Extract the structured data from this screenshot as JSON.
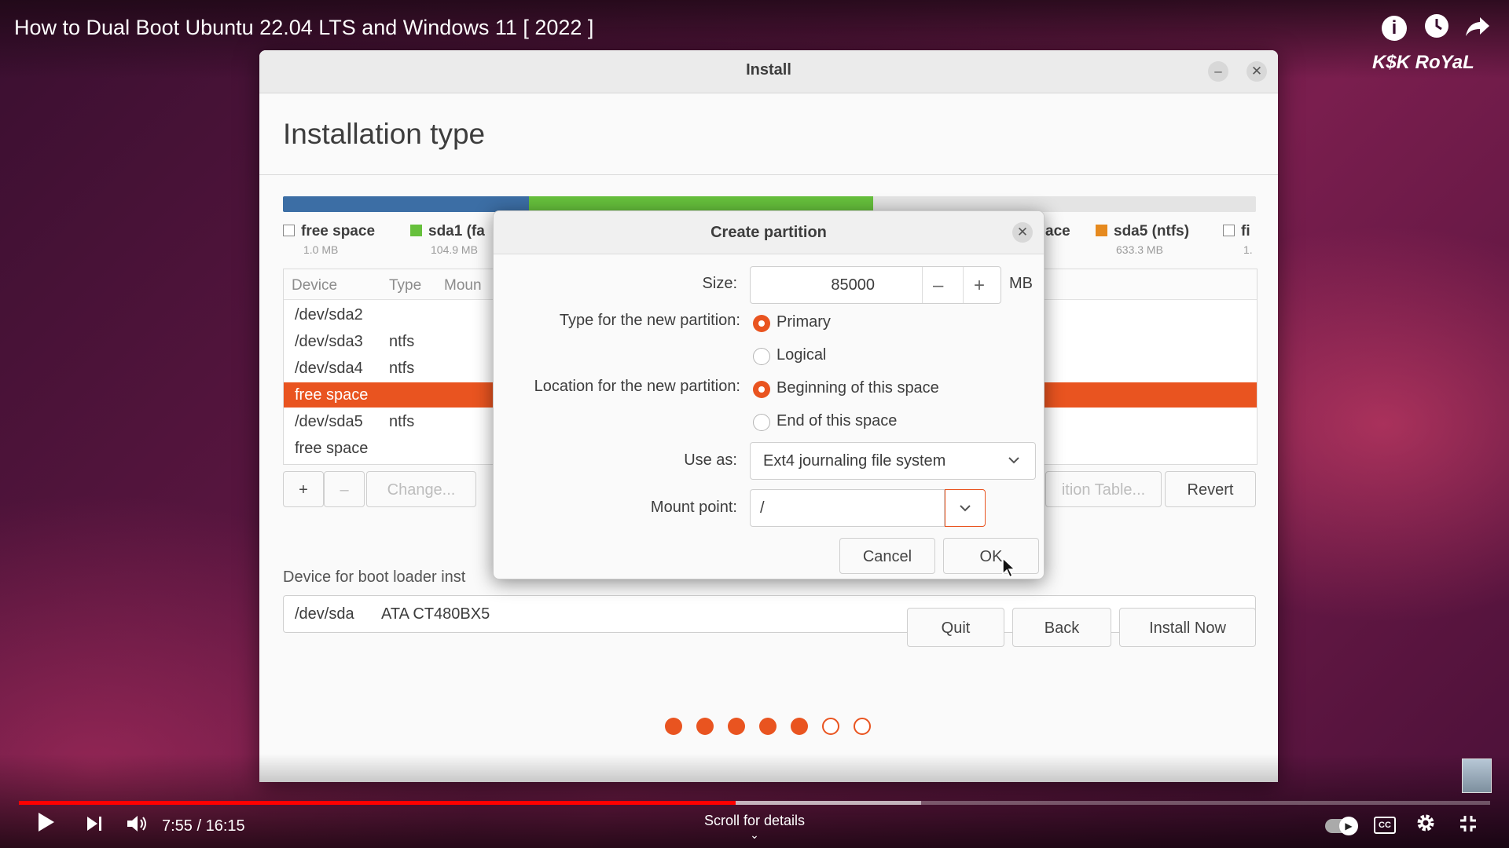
{
  "video": {
    "title": "How to Dual Boot Ubuntu 22.04 LTS and Windows 11 [ 2022 ]",
    "channel_watermark": "K$K RoYaL",
    "top_icons": [
      "info-icon",
      "clock-icon",
      "share-icon"
    ]
  },
  "installer": {
    "window_title": "Install",
    "minimize_glyph": "–",
    "close_glyph": "✕",
    "page_heading": "Installation type",
    "partition_bar": {
      "segments": [
        {
          "name": "sda1",
          "color": "#3c6ea5",
          "fraction": 0.253
        },
        {
          "name": "sda2",
          "color": "#66c03c",
          "fraction": 0.354
        },
        {
          "name": "free",
          "color": "#e4e4e4",
          "fraction": 0.393
        }
      ]
    },
    "legend": [
      {
        "label": "free space",
        "size": "1.0 MB",
        "color": "#ffffff"
      },
      {
        "label": "sda1 (fa",
        "size": "104.9 MB",
        "color": "#66c03c"
      },
      {
        "label": "ace",
        "size": "",
        "color": ""
      },
      {
        "label": "sda5 (ntfs)",
        "size": "633.3 MB",
        "color": "#e68a1f"
      },
      {
        "label": "fi",
        "size": "1.",
        "color": "#ffffff"
      }
    ],
    "table": {
      "headers": [
        "Device",
        "Type",
        "Moun"
      ],
      "rows": [
        {
          "device": "/dev/sda2",
          "type": "",
          "selected": false
        },
        {
          "device": "/dev/sda3",
          "type": "ntfs",
          "selected": false
        },
        {
          "device": "/dev/sda4",
          "type": "ntfs",
          "selected": false
        },
        {
          "device": "free space",
          "type": "",
          "selected": true
        },
        {
          "device": "/dev/sda5",
          "type": "ntfs",
          "selected": false
        },
        {
          "device": "free space",
          "type": "",
          "selected": false
        }
      ]
    },
    "table_buttons": {
      "add": "+",
      "remove": "–",
      "change": "Change...",
      "new_table": "ition Table...",
      "revert": "Revert"
    },
    "boot_loader_label": "Device for boot loader inst",
    "boot_loader_device": "/dev/sda",
    "boot_loader_model": "ATA CT480BX5",
    "nav_buttons": {
      "quit": "Quit",
      "back": "Back",
      "install_now": "Install Now"
    },
    "progress_dots": {
      "total": 7,
      "filled": 5
    }
  },
  "dialog": {
    "title": "Create partition",
    "size_label": "Size:",
    "size_value": "85000",
    "size_unit": "MB",
    "minus": "–",
    "plus": "+",
    "type_label": "Type for the new partition:",
    "type_options": [
      {
        "label": "Primary",
        "checked": true
      },
      {
        "label": "Logical",
        "checked": false
      }
    ],
    "location_label": "Location for the new partition:",
    "location_options": [
      {
        "label": "Beginning of this space",
        "checked": true
      },
      {
        "label": "End of this space",
        "checked": false
      }
    ],
    "use_as_label": "Use as:",
    "use_as_value": "Ext4 journaling file system",
    "mount_label": "Mount point:",
    "mount_value": "/",
    "cancel": "Cancel",
    "ok": "OK"
  },
  "player": {
    "time": "7:55 / 16:15",
    "scroll_hint": "Scroll for details",
    "played_fraction": 0.487,
    "buffered_fraction": 0.613,
    "accent": "#ff0000"
  }
}
